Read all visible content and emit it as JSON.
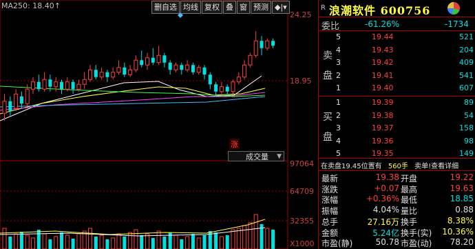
{
  "ma_label": "MA250: 18.40↑",
  "toolbar": [
    "删自选",
    "均线",
    "复权",
    "叠",
    "窗",
    "预测",
    "◆|▾"
  ],
  "price_axis": {
    "top": "24.25",
    "mid": "18.95",
    "bottom": ""
  },
  "volume_axis": {
    "top": "97064",
    "mid": "64709",
    "low": "32355",
    "unit": "X1000"
  },
  "zhang_badge": "涨",
  "vol_dropdown": "成交量",
  "header": {
    "r_mark": "R",
    "name": "浪潮软件",
    "code": "600756"
  },
  "weibi": {
    "label": "委比",
    "pct": "-61.26%",
    "diff": "-1734"
  },
  "sell_label": [
    "卖",
    "盘"
  ],
  "buy_label": [
    "买",
    "盘"
  ],
  "sell_orders": [
    {
      "level": "5",
      "price": "19.44",
      "vol": "521"
    },
    {
      "level": "4",
      "price": "19.43",
      "vol": "204"
    },
    {
      "level": "3",
      "price": "19.42",
      "vol": "409"
    },
    {
      "level": "2",
      "price": "19.41",
      "vol": "541"
    },
    {
      "level": "1",
      "price": "19.40",
      "vol": "607"
    }
  ],
  "buy_orders": [
    {
      "level": "1",
      "price": "19.39",
      "vol": "89"
    },
    {
      "level": "2",
      "price": "19.38",
      "vol": "54"
    },
    {
      "level": "3",
      "price": "19.37",
      "vol": "158"
    },
    {
      "level": "4",
      "price": "19.36",
      "vol": "98"
    },
    {
      "level": "5",
      "price": "19.35",
      "vol": "149"
    }
  ],
  "info_bar": {
    "text": "在卖盘19.45位置有",
    "qty": "560手",
    "action": "卖单!查看详细"
  },
  "quote": [
    {
      "l1": "最新",
      "v1": "19.38",
      "c1": "red",
      "l2": "开盘",
      "v2": "19.22",
      "c2": "red"
    },
    {
      "l1": "涨跌",
      "v1": "+0.07",
      "c1": "red",
      "l2": "最高",
      "v2": "19.63",
      "c2": "red"
    },
    {
      "l1": "涨幅",
      "v1": "+0.36%",
      "c1": "red",
      "l2": "最低",
      "v2": "18.85",
      "c2": "green"
    },
    {
      "l1": "振幅",
      "v1": "4.04%",
      "c1": "white",
      "l2": "量比",
      "v2": "0.88",
      "c2": "white"
    },
    {
      "l1": "总手",
      "v1": "27.16万",
      "c1": "yellow",
      "l2": "换手",
      "v2": "8.38%",
      "c2": "yellow"
    },
    {
      "l1": "金额",
      "v1": "5.24亿",
      "c1": "cyan",
      "l2": "换手(实)",
      "v2": "10.36%",
      "c2": "yellow"
    },
    {
      "l1": "市盈(静)",
      "v1": "50.78",
      "c1": "white",
      "l2": "市盈(动)",
      "v2": "78.20",
      "c2": "white"
    }
  ],
  "colors": {
    "up": "#ff4040",
    "down": "#00e0e0",
    "frame": "#a00000",
    "ma5": "#ffffff",
    "ma10": "#ffff40",
    "ma20": "#ff40ff",
    "ma60": "#40ff40"
  }
}
